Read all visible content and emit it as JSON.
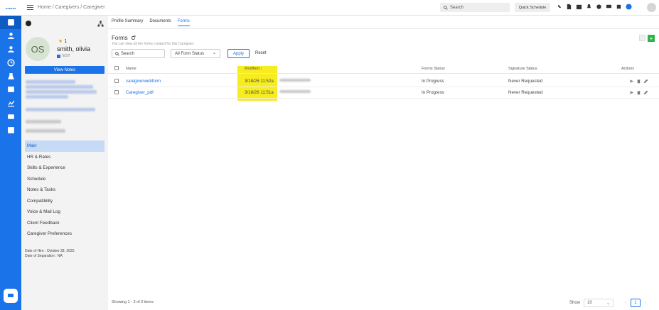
{
  "rail": {
    "items": [
      "dashboard-icon",
      "client-icon",
      "caregiver-icon",
      "schedule-icon",
      "lab-icon",
      "billing-icon",
      "reports-icon",
      "messages-icon",
      "calendar-grid-icon"
    ],
    "chat_icon": "chat-icon"
  },
  "topbar": {
    "breadcrumb": "Home / Caregivers / Caregiver",
    "search_placeholder": "Search",
    "quick_schedule": "Quick Schedule"
  },
  "profile": {
    "initials": "OS",
    "rating": "1",
    "name": "smith, olivia",
    "timezone": "EST",
    "view_notes": "View Notes",
    "menu": [
      "Main",
      "HR & Rates",
      "Skills & Experience",
      "Schedule",
      "Notes & Tasks",
      "Compatibility",
      "Voice & Mail Log",
      "Client Feedback",
      "Caregiver Preferences"
    ],
    "date_of_hire": "Date of Hire : October 28, 2025",
    "date_of_separation": "Date of Separation : NA"
  },
  "tabs": [
    "Profile Summary",
    "Documents",
    "Forms"
  ],
  "forms": {
    "title": "Forms",
    "subtitle": "You can view all the forms created for this Caregiver.",
    "search_placeholder": "Search",
    "status_filter": "All Form Status",
    "apply": "Apply",
    "reset": "Reset",
    "columns": {
      "name": "Name",
      "modified": "Modified ↓",
      "status": "Forms Status",
      "signature": "Signature Status",
      "actions": "Actions"
    },
    "rows": [
      {
        "name": "caregiverwebform",
        "modified": "3/18/26 11:52a",
        "status": "In Progress",
        "signature": "Never Requested"
      },
      {
        "name": "Caregiver_pdf",
        "modified": "3/18/26 11:51a",
        "status": "In Progress",
        "signature": "Never Requested"
      }
    ],
    "footer": "Showing 1 - 2 of 2 items",
    "show_label": "Show",
    "page_size": "10",
    "page": "1"
  },
  "colors": {
    "brand": "#1a73e8",
    "highlight": "#f6ec1f",
    "add": "#2cb34a"
  }
}
